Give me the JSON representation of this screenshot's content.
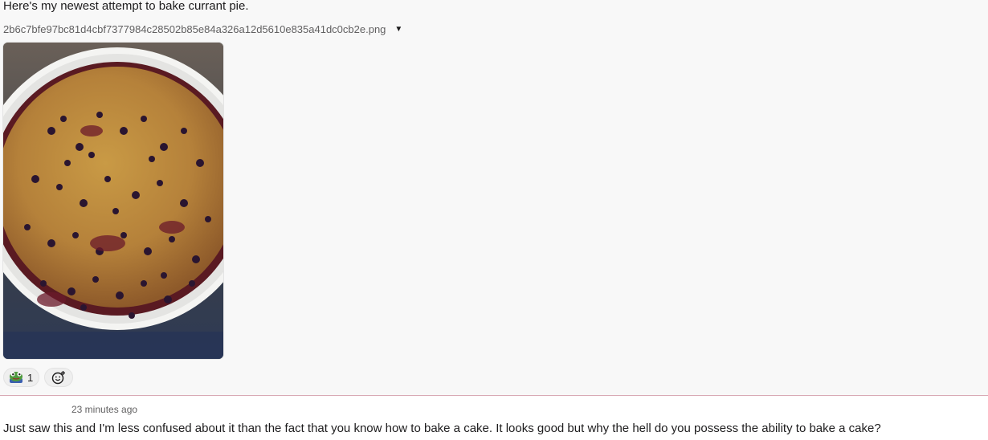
{
  "message": {
    "text": "Here's my newest attempt to bake currant pie.",
    "file": {
      "name": "2b6c7bfe97bc81d4cbf7377984c28502b85e84a326a12d5610e835a41dc0cb2e.png",
      "caret": "▼"
    },
    "image_alt": "currant-pie-photo",
    "reactions": [
      {
        "emoji": "frog-emoji",
        "count": "1"
      }
    ],
    "add_reaction_icon": "add-reaction-icon"
  },
  "reply": {
    "timestamp": "23 minutes ago",
    "text": "Just saw this and I'm less confused about it than the fact that you know how to bake a cake. It looks good but why the hell do you possess the ability to bake a cake?"
  },
  "colors": {
    "message_bg": "#f8f8f8",
    "divider": "#d8a9b4",
    "text": "#1d1c1d",
    "muted": "#616061"
  }
}
